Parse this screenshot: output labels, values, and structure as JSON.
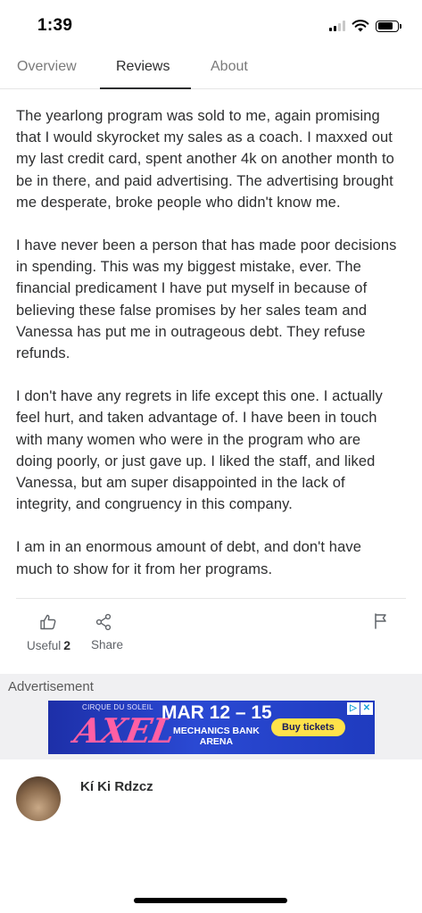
{
  "status": {
    "time": "1:39"
  },
  "tabs": [
    {
      "label": "Overview"
    },
    {
      "label": "Reviews",
      "active": true
    },
    {
      "label": "About"
    }
  ],
  "review": {
    "paragraphs": [
      "The yearlong program was sold to me, again promising that I would skyrocket my sales as a coach. I maxxed out my last credit card, spent another 4k on another month to be in there, and paid advertising. The advertising brought me desperate, broke people who didn't know me.",
      "I have never been a person that has made poor decisions in spending. This was my biggest mistake, ever. The financial predicament I have put myself in because of believing these false promises by her sales team and Vanessa has put me in outrageous debt. They refuse refunds.",
      "I don't have any regrets in life except this one. I actually feel hurt, and taken advantage of. I have been in touch with many women who were in the program who are doing poorly, or just gave up. I liked the staff, and liked Vanessa, but am super disappointed in the lack of integrity, and congruency in this company.",
      "I am in an enormous amount of debt, and don't have much to show for it from her programs."
    ],
    "actions": {
      "useful_label": "Useful",
      "useful_count": "2",
      "share_label": "Share",
      "useful_icon": "thumbs-up-icon",
      "share_icon": "share-icon",
      "flag_icon": "flag-icon"
    }
  },
  "advertisement": {
    "label": "Advertisement",
    "brand": "CIRQUE DU SOLEIL",
    "show": "AXEL",
    "dates": "MAR 12 – 15",
    "venue_line1": "MECHANICS BANK",
    "venue_line2": "ARENA",
    "cta": "Buy tickets"
  },
  "next_review": {
    "name": "Kí Ki Rdzcz"
  }
}
